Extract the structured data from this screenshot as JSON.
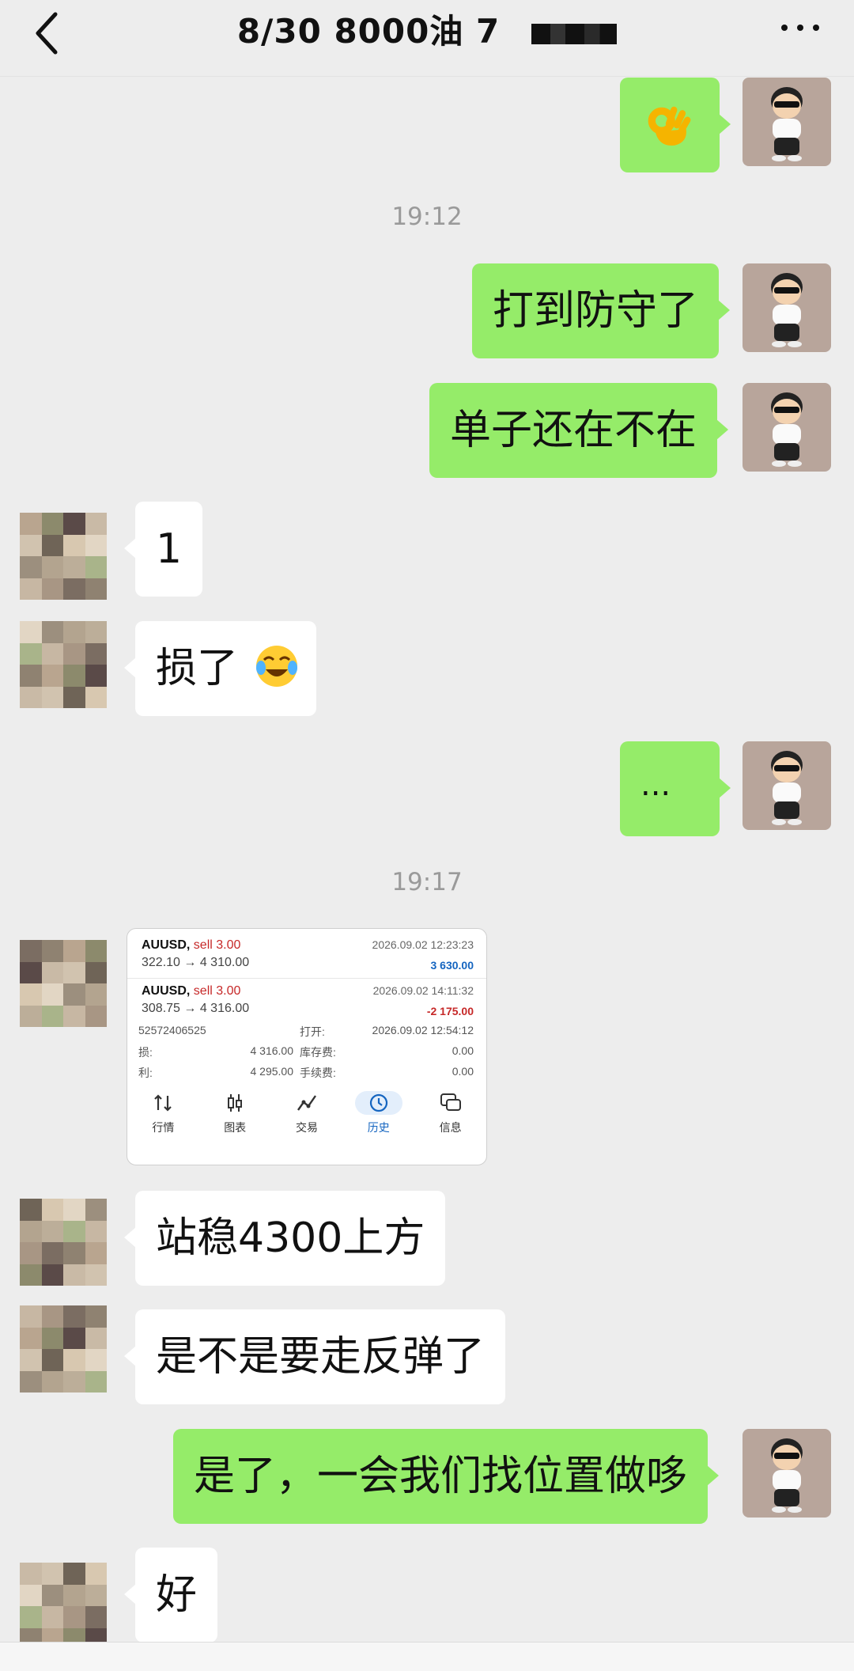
{
  "header": {
    "title": "8/30  8000油  7",
    "back_icon": "chevron-left-icon",
    "more_icon": "ellipsis-icon"
  },
  "timestamps": {
    "t1": "19:12",
    "t2": "19:17"
  },
  "messages": {
    "m1": {
      "side": "me",
      "content": "ok-hand-emoji"
    },
    "m2": {
      "side": "me",
      "text": "打到防守了"
    },
    "m3": {
      "side": "me",
      "text": "单子还在不在"
    },
    "m4": {
      "side": "them",
      "text": "1"
    },
    "m5": {
      "side": "them",
      "text": "损了"
    },
    "m6": {
      "side": "me",
      "text": "..."
    },
    "m8": {
      "side": "them",
      "text": "站稳4300上方"
    },
    "m9": {
      "side": "them",
      "text": "是不是要走反弹了"
    },
    "m10": {
      "side": "me",
      "text": "是了，一会我们找位置做哆"
    },
    "m11": {
      "side": "them",
      "text": "好"
    }
  },
  "screenshot": {
    "order1": {
      "symbol": "AUUSD,",
      "action": "sell 3.00",
      "date": "2026.09.02 12:23:23",
      "prices": "322.10 → 4 310.00",
      "pnl": "3 630.00",
      "pnl_color": "#1565c0"
    },
    "order2": {
      "symbol": "AUUSD,",
      "action": "sell 3.00",
      "date": "2026.09.02 14:11:32",
      "prices": "308.75 → 4 316.00",
      "pnl": "-2 175.00",
      "pnl_color": "#c62828"
    },
    "detail": {
      "id": "52572406525",
      "open_label": "打开:",
      "open_value": "2026.09.02 12:54:12",
      "sl_label": "损:",
      "sl_value": "4 316.00",
      "swap_label": "库存费:",
      "swap_value": "0.00",
      "tp_label": "利:",
      "tp_value": "4 295.00",
      "fee_label": "手续费:",
      "fee_value": "0.00"
    },
    "nav": [
      "行情",
      "图表",
      "交易",
      "历史",
      "信息"
    ],
    "nav_active": "历史"
  },
  "colors": {
    "me_bubble": "#95ec69",
    "them_bubble": "#ffffff",
    "background": "#ededed"
  }
}
